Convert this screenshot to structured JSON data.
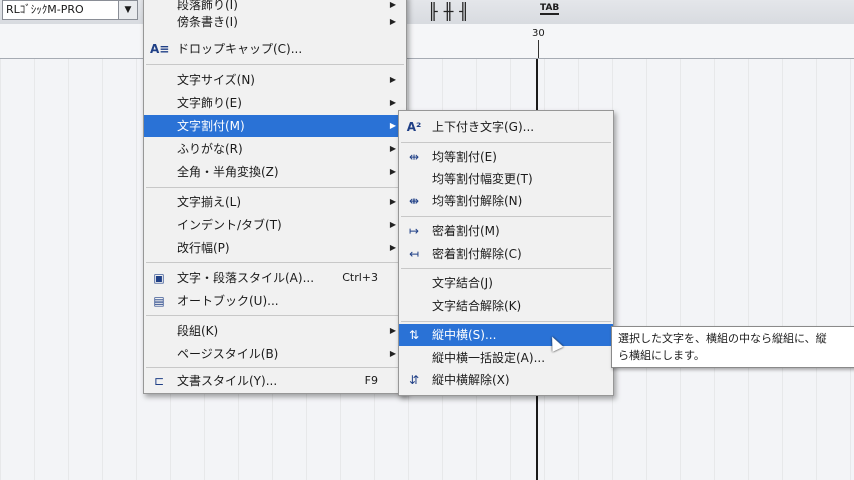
{
  "toolbar": {
    "font_name": "RLｺﾞｼｯｸM-PRO",
    "font_dropdown": "▼",
    "tab_label": "TAB"
  },
  "ruler": {
    "mark": "30"
  },
  "main_menu": {
    "items": [
      {
        "label": "段落飾り(I)",
        "arrow": "▶"
      },
      {
        "label": "傍条書き(I)",
        "arrow": "▶"
      },
      {
        "label": "ドロップキャップ(C)...",
        "icon": "drop-cap-icon"
      },
      {
        "label": "文字サイズ(N)",
        "arrow": "▶"
      },
      {
        "label": "文字飾り(E)",
        "arrow": "▶"
      },
      {
        "label": "文字割付(M)",
        "arrow": "▶"
      },
      {
        "label": "ふりがな(R)",
        "arrow": "▶"
      },
      {
        "label": "全角・半角変換(Z)",
        "arrow": "▶"
      },
      {
        "label": "文字揃え(L)",
        "arrow": "▶"
      },
      {
        "label": "インデント/タブ(T)",
        "arrow": "▶"
      },
      {
        "label": "改行幅(P)",
        "arrow": "▶"
      },
      {
        "label": "文字・段落スタイル(A)...",
        "shortcut": "Ctrl+3",
        "icon": "paragraph-style-icon"
      },
      {
        "label": "オートブック(U)...",
        "icon": "autobook-icon"
      },
      {
        "label": "段組(K)",
        "arrow": "▶"
      },
      {
        "label": "ページスタイル(B)",
        "arrow": "▶"
      },
      {
        "label": "文書スタイル(Y)...",
        "shortcut": "F9",
        "icon": "document-style-icon"
      }
    ]
  },
  "sub_menu": {
    "items": [
      {
        "label": "上下付き文字(G)...",
        "icon": "superscript-icon"
      },
      {
        "label": "均等割付(E)",
        "icon": "equal-spacing-icon"
      },
      {
        "label": "均等割付幅変更(T)"
      },
      {
        "label": "均等割付解除(N)",
        "icon": "equal-spacing-remove-icon"
      },
      {
        "label": "密着割付(M)",
        "icon": "tight-spacing-icon"
      },
      {
        "label": "密着割付解除(C)",
        "icon": "tight-spacing-remove-icon"
      },
      {
        "label": "文字結合(J)"
      },
      {
        "label": "文字結合解除(K)"
      },
      {
        "label": "縦中横(S)...",
        "icon": "tate-chu-yoko-icon"
      },
      {
        "label": "縦中横一括設定(A)..."
      },
      {
        "label": "縦中横解除(X)",
        "icon": "tate-chu-yoko-remove-icon"
      }
    ]
  },
  "tooltip": {
    "line1": "選択した文字を、横組の中なら縦組に、縦",
    "line2": "ら横組にします。"
  }
}
